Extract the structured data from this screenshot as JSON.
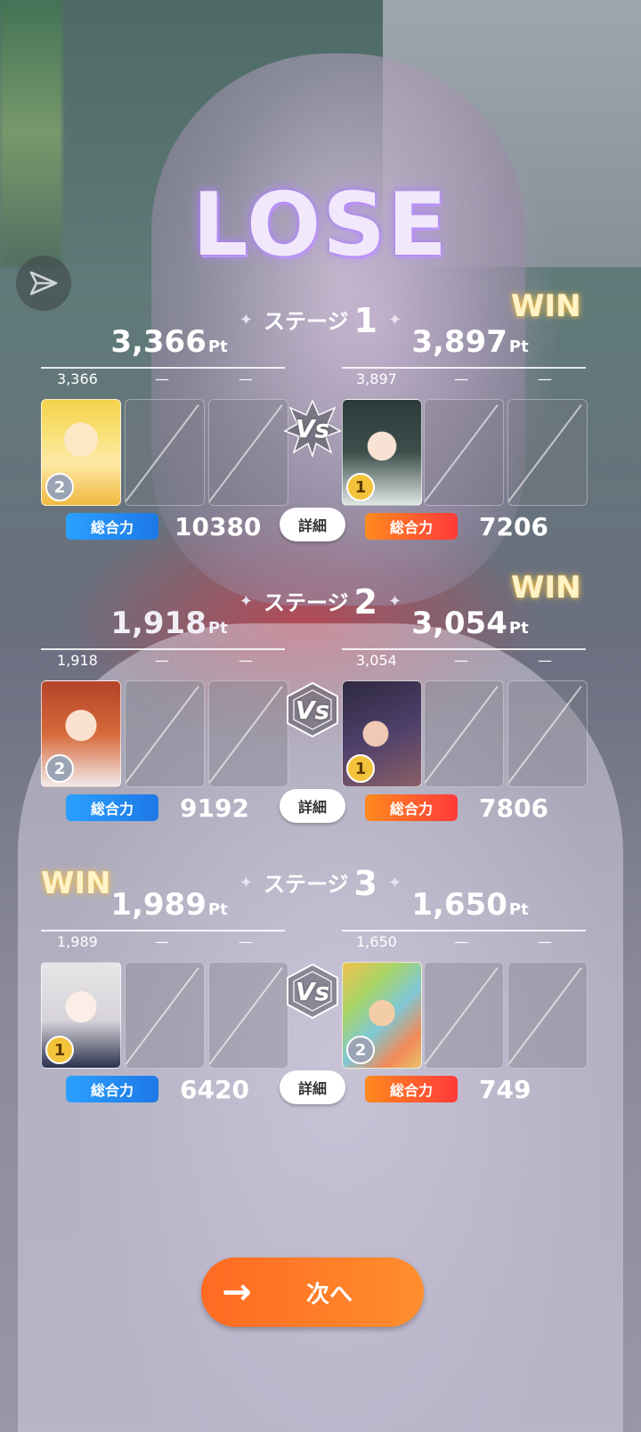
{
  "result": {
    "title": "LOSE"
  },
  "stage_word": "ステージ",
  "power_label": "総合力",
  "detail_label": "詳細",
  "pt_unit": "Pt",
  "win_label": "WIN",
  "vs_label": "Vs",
  "dash": "—",
  "next_label": "次へ",
  "stages": [
    {
      "number": "1",
      "winner": "right",
      "left": {
        "total": "3,366",
        "scores": [
          "3,366"
        ],
        "rank": "2",
        "power": "10380"
      },
      "right": {
        "total": "3,897",
        "scores": [
          "3,897"
        ],
        "rank": "1",
        "power": "7206"
      }
    },
    {
      "number": "2",
      "winner": "right",
      "left": {
        "total": "1,918",
        "scores": [
          "1,918"
        ],
        "rank": "2",
        "power": "9192"
      },
      "right": {
        "total": "3,054",
        "scores": [
          "3,054"
        ],
        "rank": "1",
        "power": "7806"
      }
    },
    {
      "number": "3",
      "winner": "left",
      "left": {
        "total": "1,989",
        "scores": [
          "1,989"
        ],
        "rank": "1",
        "power": "6420"
      },
      "right": {
        "total": "1,650",
        "scores": [
          "1,650"
        ],
        "rank": "2",
        "power": "749"
      }
    }
  ]
}
